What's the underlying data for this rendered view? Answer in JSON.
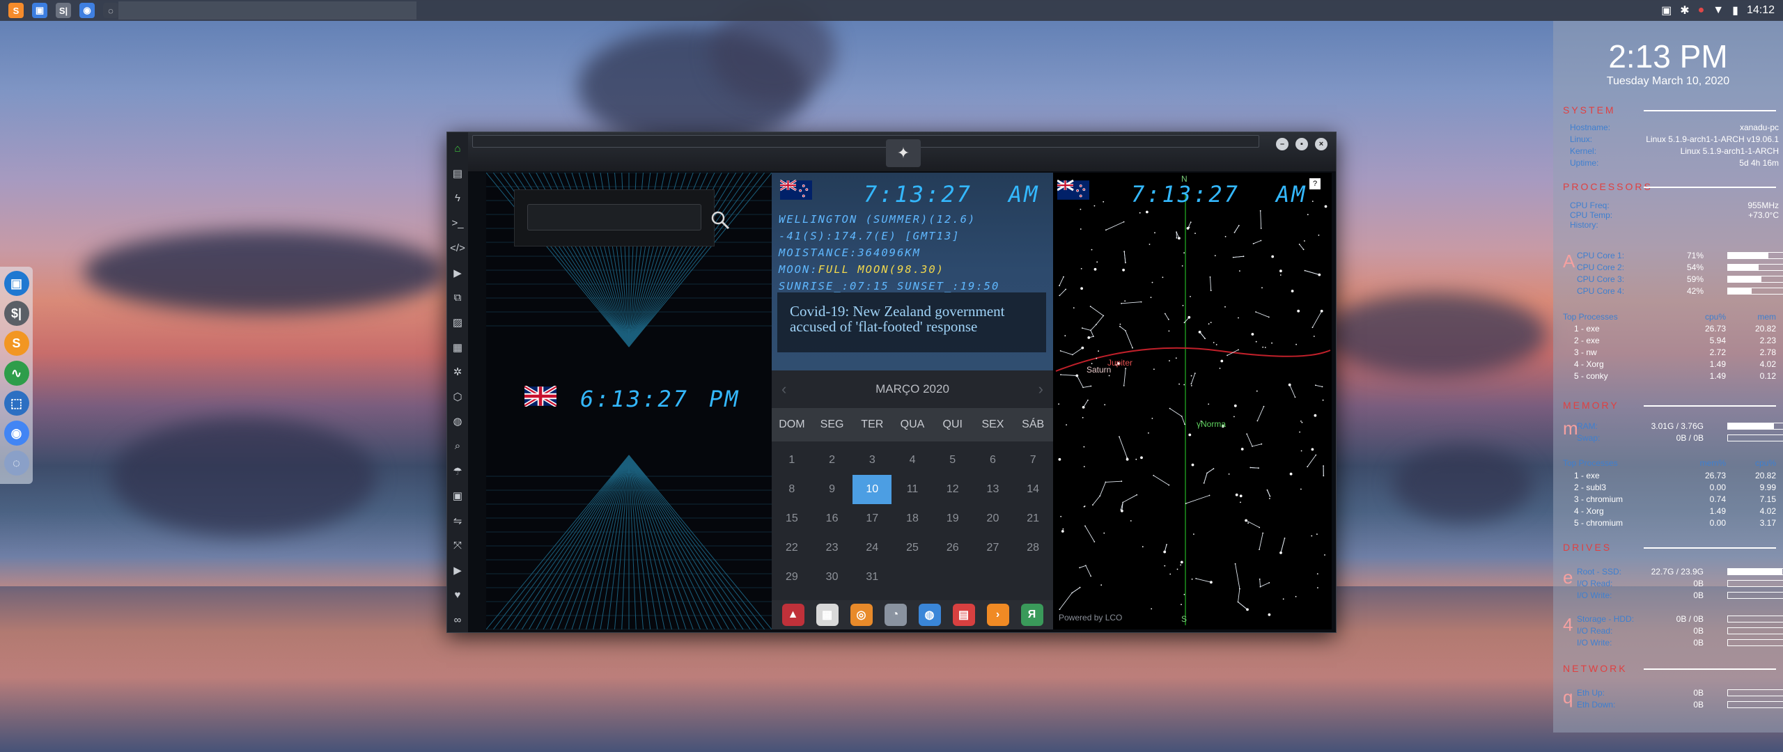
{
  "top_panel": {
    "apps": [
      {
        "name": "sublime-icon",
        "glyph": "S",
        "color": "#f58b2b"
      },
      {
        "name": "files-icon",
        "glyph": "▣",
        "color": "#3c7ee0"
      },
      {
        "name": "clock-app-icon",
        "glyph": "S|",
        "color": "#6b7280"
      },
      {
        "name": "chromium-icon",
        "glyph": "◉",
        "color": "#3f7fe0"
      },
      {
        "name": "active-window-icon",
        "glyph": "◌",
        "color": "#3b4250"
      }
    ],
    "time": "14:12"
  },
  "dock": {
    "items": [
      {
        "name": "files-dock",
        "glyph": "▣",
        "color": "#1f78d1"
      },
      {
        "name": "clock-dock",
        "glyph": "$|",
        "color": "#5a5f66"
      },
      {
        "name": "sublime-dock",
        "glyph": "S",
        "color": "#f29622"
      },
      {
        "name": "monitor-dock",
        "glyph": "∿",
        "color": "#2e9d4a"
      },
      {
        "name": "screenshot-dock",
        "glyph": "⬚",
        "color": "#2c6fc2"
      },
      {
        "name": "chromium-dock",
        "glyph": "◉",
        "color": "#4285f4"
      },
      {
        "name": "globe-dock",
        "glyph": "◌",
        "color": "#8aa0c8"
      }
    ]
  },
  "window": {
    "sidebar": [
      "home-icon",
      "document-icon",
      "bolt-icon",
      "terminal-icon",
      "code-icon",
      "play-icon",
      "files-icon",
      "image-icon",
      "news-icon",
      "settings-icon",
      "hexagon-icon",
      "globe-icon",
      "search-icon",
      "umbrella-icon",
      "contact-icon",
      "swap-icon",
      "expand-icon",
      "youtube-icon",
      "heart-icon",
      "infinity-icon"
    ]
  },
  "clock_uk": {
    "time": "6:13:27",
    "ampm": "PM"
  },
  "search": {
    "placeholder": ""
  },
  "nz": {
    "time": "7:13:27",
    "ampm": "AM",
    "line1": "WELLINGTON (SUMMER)(12.6)",
    "line2": "-41(S):174.7(E) [GMT13]",
    "line3": "MOISTANCE:364096KM",
    "moon_label": "MOON:",
    "moon_value": "FULL MOON(98.30)",
    "line5": "SUNRISE_:07:15 SUNSET_:19:50",
    "news": "Covid-19: New Zealand government accused of 'flat-footed' response"
  },
  "calendar": {
    "month": "MARÇO 2020",
    "prev": "‹",
    "next": "›",
    "dow": [
      "DOM",
      "SEG",
      "TER",
      "QUA",
      "QUI",
      "SEX",
      "SÁB"
    ],
    "weeks": [
      [
        "1",
        "2",
        "3",
        "4",
        "5",
        "6",
        "7"
      ],
      [
        "8",
        "9",
        "10",
        "11",
        "12",
        "13",
        "14"
      ],
      [
        "15",
        "16",
        "17",
        "18",
        "19",
        "20",
        "21"
      ],
      [
        "22",
        "23",
        "24",
        "25",
        "26",
        "27",
        "28"
      ],
      [
        "29",
        "30",
        "31",
        "",
        "",
        "",
        ""
      ]
    ],
    "selected": "10"
  },
  "app_tray": [
    {
      "name": "arch-app",
      "glyph": "▲",
      "color": "#c0313a"
    },
    {
      "name": "calendar-app",
      "glyph": "▦",
      "color": "#d9d9d9"
    },
    {
      "name": "search-app",
      "glyph": "◎",
      "color": "#e88a2a"
    },
    {
      "name": "clock-app",
      "glyph": "◔",
      "color": "#8a93a0"
    },
    {
      "name": "web-app",
      "glyph": "◍",
      "color": "#3a86d8"
    },
    {
      "name": "agenda-app",
      "glyph": "▤",
      "color": "#d84040"
    },
    {
      "name": "arrow-app",
      "glyph": "›",
      "color": "#f08a24"
    },
    {
      "name": "yandex-app",
      "glyph": "Я",
      "color": "#3a9a5a"
    }
  ],
  "sky": {
    "time": "7:13:27",
    "ampm": "AM",
    "help": "?",
    "north": "N",
    "south": "S",
    "powered": "Powered by LCO",
    "saturn": "Saturn",
    "jupiter": "Jupiter",
    "neptune": "γNorma"
  },
  "conky": {
    "time": "2:13 PM",
    "date": "Tuesday March 10, 2020",
    "system": {
      "title": "SYSTEM",
      "rows": [
        {
          "label": "Hostname:",
          "value": "xanadu-pc"
        },
        {
          "label": "Linux:",
          "value": "Linux 5.1.9-arch1-1-ARCH v19.06.1"
        },
        {
          "label": "Kernel:",
          "value": "Linux 5.1.9-arch1-1-ARCH"
        },
        {
          "label": "Uptime:",
          "value": "5d 4h 16m"
        }
      ]
    },
    "processors": {
      "title": "PROCESSORS",
      "rows": [
        {
          "label": "CPU Freq:",
          "value": "955MHz"
        },
        {
          "label": "CPU Temp:",
          "value": "+73.0°C"
        },
        {
          "label": "History:",
          "value": ""
        }
      ],
      "letter": "A",
      "cores": [
        {
          "label": "CPU Core 1:",
          "value": "71%",
          "fill": 0.71
        },
        {
          "label": "CPU Core 2:",
          "value": "54%",
          "fill": 0.54
        },
        {
          "label": "CPU Core 3:",
          "value": "59%",
          "fill": 0.59
        },
        {
          "label": "CPU Core 4:",
          "value": "42%",
          "fill": 0.42
        }
      ],
      "top_title": "Top Processes",
      "col1": "cpu%",
      "col2": "mem",
      "procs": [
        {
          "name": "1 - exe",
          "a": "26.73",
          "b": "20.82"
        },
        {
          "name": "2 - exe",
          "a": "5.94",
          "b": "2.23"
        },
        {
          "name": "3 - nw",
          "a": "2.72",
          "b": "2.78"
        },
        {
          "name": "4 - Xorg",
          "a": "1.49",
          "b": "4.02"
        },
        {
          "name": "5 - conky",
          "a": "1.49",
          "b": "0.12"
        }
      ]
    },
    "memory": {
      "title": "MEMORY",
      "letter": "m",
      "rows": [
        {
          "label": "RAM:",
          "value": "3.01G / 3.76G",
          "fill": 0.8
        },
        {
          "label": "Swap:",
          "value": "0B / 0B",
          "fill": 0
        }
      ],
      "top_title": "Top Processes",
      "col1": "mem%",
      "col2": "cpu%",
      "procs": [
        {
          "name": "1 - exe",
          "a": "26.73",
          "b": "20.82"
        },
        {
          "name": "2 - subl3",
          "a": "0.00",
          "b": "9.99"
        },
        {
          "name": "3 - chromium",
          "a": "0.74",
          "b": "7.15"
        },
        {
          "name": "4 - Xorg",
          "a": "1.49",
          "b": "4.02"
        },
        {
          "name": "5 - chromium",
          "a": "0.00",
          "b": "3.17"
        }
      ]
    },
    "drives": {
      "title": "DRIVES",
      "letter": "e",
      "rows": [
        {
          "label": "Root - SSD:",
          "value": "22.7G / 23.9G",
          "fill": 0.95
        },
        {
          "label": "I/O Read:",
          "value": "0B",
          "fill": 0
        },
        {
          "label": "I/O Write:",
          "value": "0B",
          "fill": 0
        }
      ],
      "letter2": "4",
      "rows2": [
        {
          "label": "Storage - HDD:",
          "value": "0B / 0B",
          "fill": 0
        },
        {
          "label": "I/O Read:",
          "value": "0B",
          "fill": 0
        },
        {
          "label": "I/O Write:",
          "value": "0B",
          "fill": 0
        }
      ]
    },
    "network": {
      "title": "NETWORK",
      "letter": "q",
      "rows": [
        {
          "label": "Eth Up:",
          "value": "0B",
          "fill": 0
        },
        {
          "label": "Eth Down:",
          "value": "0B",
          "fill": 0
        }
      ]
    }
  }
}
